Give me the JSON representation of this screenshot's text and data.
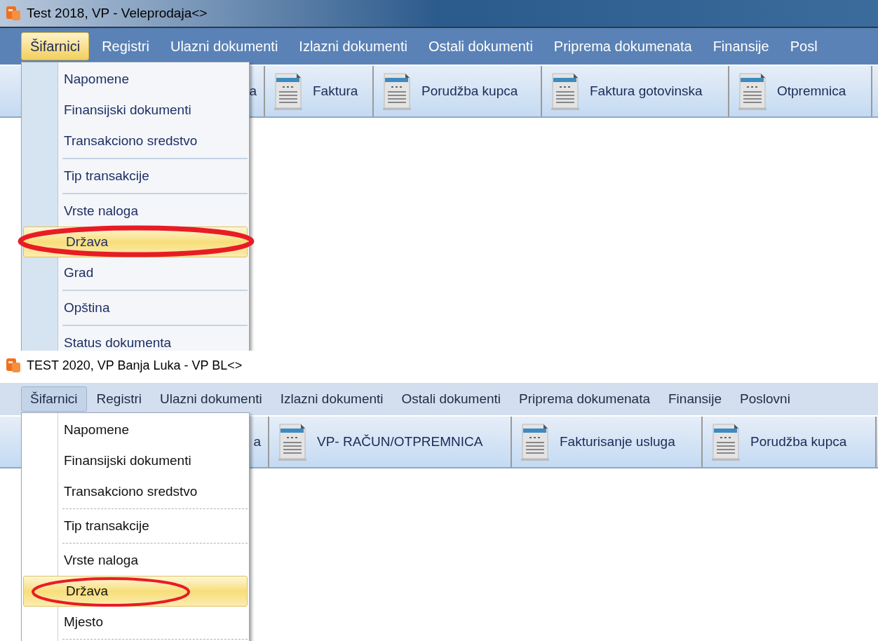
{
  "panels": [
    {
      "kind": "blue",
      "window": {
        "title": "Test 2018, VP - Veleprodaja<>"
      },
      "menu_bar": [
        {
          "label": "Šifarnici",
          "selected": true
        },
        {
          "label": "Registri",
          "selected": false
        },
        {
          "label": "Ulazni dokumenti",
          "selected": false
        },
        {
          "label": "Izlazni dokumenti",
          "selected": false
        },
        {
          "label": "Ostali dokumenti",
          "selected": false
        },
        {
          "label": "Priprema dokumenata",
          "selected": false
        },
        {
          "label": "Finansije",
          "selected": false
        },
        {
          "label": "Posl",
          "selected": false
        }
      ],
      "toolbar": [
        "a",
        "Faktura",
        "Porudžba kupca",
        "Faktura gotovinska",
        "Otpremnica"
      ],
      "dropdown": [
        {
          "label": "Napomene",
          "selected": false,
          "divider_after": false
        },
        {
          "label": "Finansijski dokumenti",
          "selected": false,
          "divider_after": false
        },
        {
          "label": "Transakciono sredstvo",
          "selected": false,
          "divider_after": true
        },
        {
          "label": "Tip transakcije",
          "selected": false,
          "divider_after": true
        },
        {
          "label": "Vrste naloga",
          "selected": false,
          "divider_after": false
        },
        {
          "label": "Država",
          "selected": true,
          "divider_after": false
        },
        {
          "label": "Grad",
          "selected": false,
          "divider_after": true
        },
        {
          "label": "Opština",
          "selected": false,
          "divider_after": true
        },
        {
          "label": "Status dokumenta",
          "selected": false,
          "divider_after": false
        }
      ]
    },
    {
      "kind": "light",
      "window": {
        "title": "TEST 2020, VP Banja Luka - VP BL<>"
      },
      "menu_bar": [
        {
          "label": "Šifarnici",
          "selected": true
        },
        {
          "label": "Registri",
          "selected": false
        },
        {
          "label": "Ulazni dokumenti",
          "selected": false
        },
        {
          "label": "Izlazni dokumenti",
          "selected": false
        },
        {
          "label": "Ostali dokumenti",
          "selected": false
        },
        {
          "label": "Priprema dokumenata",
          "selected": false
        },
        {
          "label": "Finansije",
          "selected": false
        },
        {
          "label": "Poslovni",
          "selected": false
        }
      ],
      "toolbar": [
        "a",
        "VP- RAČUN/OTPREMNICA",
        "Fakturisanje usluga",
        "Porudžba kupca"
      ],
      "dropdown": [
        {
          "label": "Napomene",
          "selected": false,
          "divider_after": false
        },
        {
          "label": "Finansijski dokumenti",
          "selected": false,
          "divider_after": false
        },
        {
          "label": "Transakciono sredstvo",
          "selected": false,
          "divider_after": true
        },
        {
          "label": "Tip transakcije",
          "selected": false,
          "divider_after": true
        },
        {
          "label": "Vrste naloga",
          "selected": false,
          "divider_after": false
        },
        {
          "label": "Država",
          "selected": true,
          "divider_after": false
        },
        {
          "label": "Mjesto",
          "selected": false,
          "divider_after": true
        }
      ]
    }
  ]
}
